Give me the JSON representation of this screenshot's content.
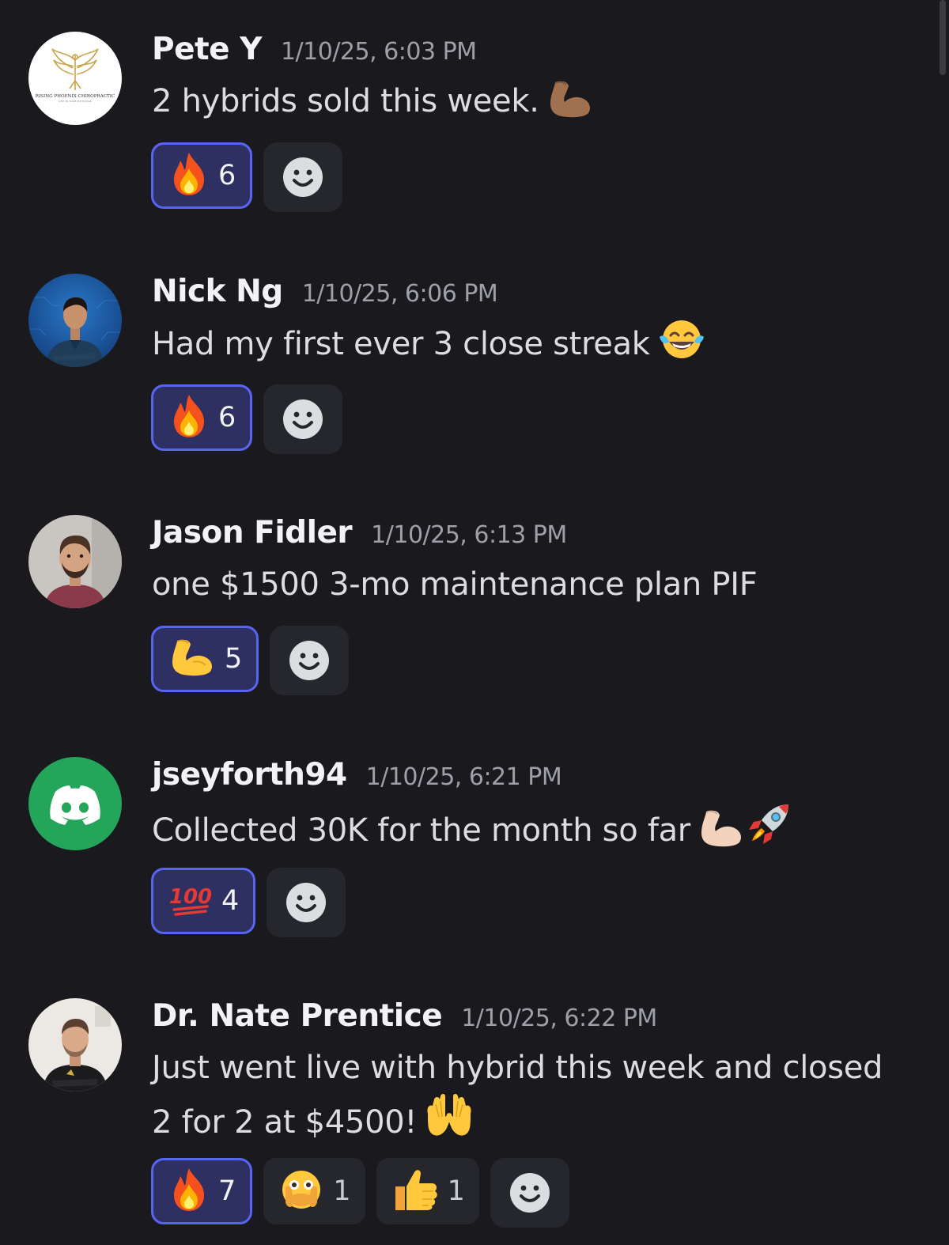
{
  "messages": [
    {
      "username": "Pete Y",
      "timestamp": "1/10/25, 6:03 PM",
      "text": "2 hybrids sold this week.",
      "text_emojis": [
        "flexed-biceps-medium-dark"
      ],
      "avatar_text": "RISING PHOENIX CHIROPRACTIC",
      "reactions": [
        {
          "emoji": "fire",
          "count": "6",
          "selected": true
        }
      ]
    },
    {
      "username": "Nick Ng",
      "timestamp": "1/10/25, 6:06 PM",
      "text": "Had my first ever 3 close streak",
      "text_emojis": [
        "face-with-tears-of-joy"
      ],
      "reactions": [
        {
          "emoji": "fire",
          "count": "6",
          "selected": true
        }
      ]
    },
    {
      "username": "Jason Fidler",
      "timestamp": "1/10/25, 6:13 PM",
      "text": "one $1500 3-mo maintenance plan PIF",
      "text_emojis": [],
      "reactions": [
        {
          "emoji": "flexed-biceps",
          "count": "5",
          "selected": true
        }
      ]
    },
    {
      "username": "jseyforth94",
      "timestamp": "1/10/25, 6:21 PM",
      "text": "Collected 30K for the month so far",
      "text_emojis": [
        "flexed-biceps-light",
        "rocket"
      ],
      "reactions": [
        {
          "emoji": "hundred-points",
          "count": "4",
          "selected": true
        }
      ]
    },
    {
      "username": "Dr. Nate Prentice",
      "timestamp": "1/10/25, 6:22 PM",
      "text_line1": "Just went live with hybrid this week and closed",
      "text_line2": "2 for 2 at $4500!",
      "text_emojis": [
        "raising-hands"
      ],
      "reactions": [
        {
          "emoji": "fire",
          "count": "7",
          "selected": true
        },
        {
          "emoji": "face-with-open-eyes-and-hand-over-mouth",
          "count": "1",
          "selected": false
        },
        {
          "emoji": "thumbs-up",
          "count": "1",
          "selected": false
        }
      ]
    }
  ],
  "colors": {
    "background": "#1a1a1e",
    "reaction_selected_bg": "#2d3060",
    "reaction_selected_border": "#5865f2",
    "reaction_bg": "#26272d",
    "discord_green": "#23a55a"
  },
  "icons": {
    "add_reaction": "smiley-face-icon"
  }
}
